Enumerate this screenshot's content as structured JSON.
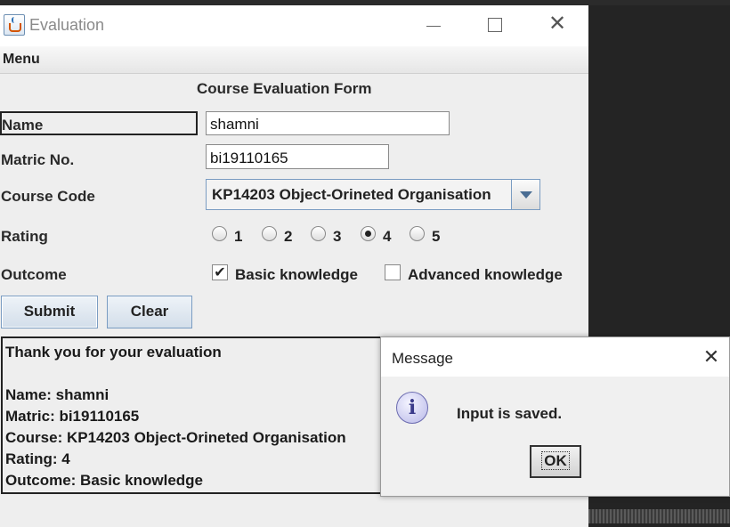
{
  "window": {
    "title": "Evaluation",
    "controls": {
      "minimize": "",
      "maximize": "",
      "close": "✕"
    }
  },
  "menu": {
    "label": "Menu"
  },
  "form": {
    "title": "Course Evaluation Form",
    "name_label": "Name",
    "name_value": "shamni",
    "matric_label": "Matric No.",
    "matric_value": "bi19110165",
    "course_label": "Course Code",
    "course_selected": "KP14203 Object-Orineted Organisation",
    "rating_label": "Rating",
    "rating_options": [
      "1",
      "2",
      "3",
      "4",
      "5"
    ],
    "rating_selected": "4",
    "outcome_label": "Outcome",
    "outcomes": [
      {
        "label": "Basic knowledge",
        "checked": true
      },
      {
        "label": "Advanced knowledge",
        "checked": false
      }
    ],
    "submit_label": "Submit",
    "clear_label": "Clear"
  },
  "output": {
    "lines": [
      "Thank you for your evaluation",
      "",
      "Name: shamni",
      "Matric: bi19110165",
      "Course: KP14203 Object-Orineted Organisation",
      "Rating: 4",
      "Outcome: Basic knowledge"
    ]
  },
  "dialog": {
    "title": "Message",
    "close": "✕",
    "icon": "information-icon",
    "icon_glyph": "i",
    "message": "Input is saved.",
    "ok_label": "OK"
  },
  "colors": {
    "window_bg": "#eeeeee",
    "desktop_bg": "#2b2b2b",
    "button_border": "#7a9cc2"
  }
}
